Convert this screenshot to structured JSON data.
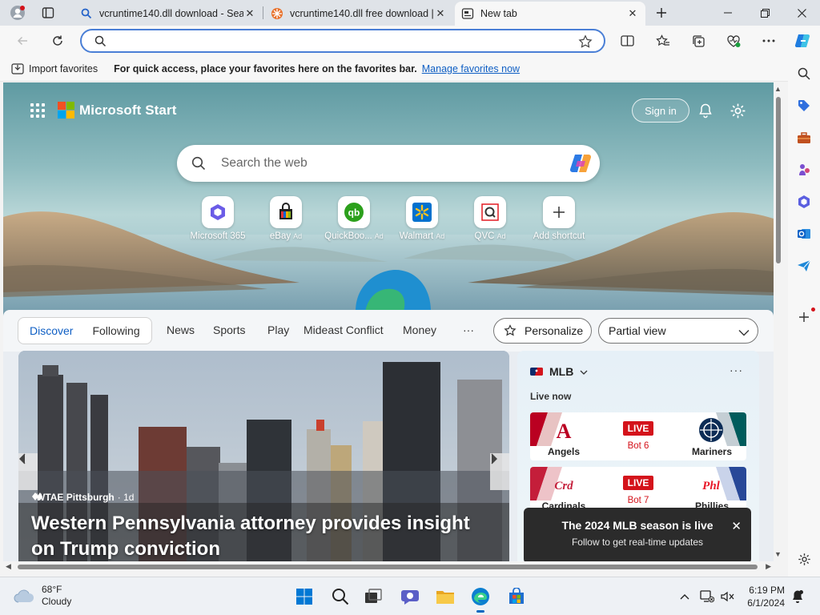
{
  "browser": {
    "tabs": [
      {
        "title": "vcruntime140.dll download - Sea",
        "favicon": "search-icon"
      },
      {
        "title": "vcruntime140.dll free download |",
        "favicon": "dll-site-icon"
      },
      {
        "title": "New tab",
        "favicon": "new-tab-page-icon",
        "active": true
      }
    ],
    "address": {
      "value": "",
      "placeholder": ""
    },
    "favorites_bar": {
      "import_label": "Import favorites",
      "hint": "For quick access, place your favorites here on the favorites bar.",
      "manage_link": "Manage favorites now"
    }
  },
  "page": {
    "brand": "Microsoft Start",
    "signin": "Sign in",
    "search_placeholder": "Search the web",
    "quick_links": [
      {
        "label": "Microsoft 365",
        "ad": ""
      },
      {
        "label": "eBay",
        "ad": "Ad"
      },
      {
        "label": "QuickBoo...",
        "ad": "Ad"
      },
      {
        "label": "Walmart",
        "ad": "Ad"
      },
      {
        "label": "QVC",
        "ad": "Ad"
      },
      {
        "label": "Add shortcut",
        "ad": ""
      }
    ],
    "feed_nav": {
      "discover": "Discover",
      "following": "Following",
      "items": [
        "News",
        "Sports",
        "Play",
        "Mideast Conflict",
        "Money"
      ],
      "more": "···",
      "personalize": "Personalize",
      "view_select": "Partial view"
    },
    "article": {
      "source": "WTAE Pittsburgh",
      "age": "· 1d",
      "headline": "Western Pennsylvania attorney provides insight on Trump conviction"
    },
    "mlb": {
      "title": "MLB",
      "more": "···",
      "live_now": "Live now",
      "games": [
        {
          "away": "Angels",
          "home": "Mariners",
          "status": "LIVE",
          "inning": "Bot 6"
        },
        {
          "away": "Cardinals",
          "home": "Phillies",
          "status": "LIVE",
          "inning": "Bot 7"
        }
      ],
      "toast": {
        "title": "The 2024 MLB season is live",
        "subtitle": "Follow to get real-time updates"
      }
    }
  },
  "taskbar": {
    "weather_temp": "68°F",
    "weather_desc": "Cloudy",
    "time": "6:19 PM",
    "date": "6/1/2024"
  },
  "colors": {
    "accent": "#0f5fc4",
    "live_red": "#d4131b",
    "ms_red": "#f25022",
    "ms_green": "#7fba00",
    "ms_blue": "#00a4ef",
    "ms_yellow": "#ffb900"
  }
}
